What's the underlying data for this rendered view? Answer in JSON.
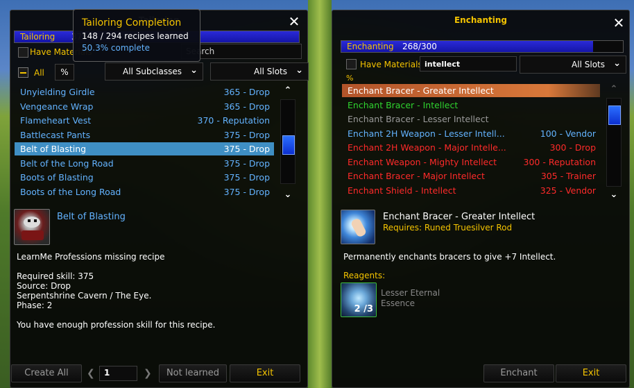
{
  "colors": {
    "yellow": "#f5c400",
    "link_blue": "#63b3ff",
    "red": "#ff2a2a",
    "green": "#2fd32f",
    "gray": "#9a9a9a",
    "selected_row": "#3f8fc4"
  },
  "left": {
    "title": "Tailoring",
    "skill": {
      "name": "Tailoring",
      "value": "375",
      "fill_fraction": 1.0
    },
    "have_materials_label": "Have Materials",
    "search_placeholder": "Search",
    "all_label": "All",
    "percent_label": "%",
    "subclass_dropdown": "All Subclasses",
    "slots_dropdown": "All Slots",
    "recipes": [
      {
        "name": "Unyielding Girdle",
        "source": "365 - Drop"
      },
      {
        "name": "Vengeance Wrap",
        "source": "365 - Drop"
      },
      {
        "name": "Flameheart Vest",
        "source": "370 - Reputation"
      },
      {
        "name": "Battlecast Pants",
        "source": "375 - Drop"
      },
      {
        "name": "Belt of Blasting",
        "source": "375 - Drop",
        "selected": true
      },
      {
        "name": "Belt of the Long Road",
        "source": "375 - Drop"
      },
      {
        "name": "Boots of Blasting",
        "source": "375 - Drop"
      },
      {
        "name": "Boots of the Long Road",
        "source": "375 - Drop"
      }
    ],
    "scroll_position": 0.55,
    "detail": {
      "icon": "belt-icon",
      "name": "Belt of Blasting",
      "addon_line": "LearnMe Professions missing recipe",
      "required_skill": "Required skill: 375",
      "source": "Source: Drop",
      "location": "Serpentshrine Cavern / The Eye.",
      "phase": "Phase: 2",
      "note": "You have enough profession skill for this recipe."
    },
    "buttons": {
      "create_all": "Create All",
      "quantity": "1",
      "not_learned": "Not learned",
      "exit": "Exit"
    }
  },
  "tooltip": {
    "title": "Tailoring Completion",
    "line1": "148 / 294 recipes learned",
    "line2": "50.3% complete"
  },
  "right": {
    "title": "Enchanting",
    "skill": {
      "name": "Enchanting",
      "value": "268/300",
      "fill_fraction": 0.893
    },
    "have_materials_label": "Have Materials",
    "search_value": "intellect",
    "percent_label": "%",
    "slots_dropdown": "All Slots",
    "recipes": [
      {
        "name": "Enchant Bracer - Greater Intellect",
        "source": "",
        "color": "#ffffff",
        "selected": true
      },
      {
        "name": "Enchant Bracer - Intellect",
        "source": "",
        "color": "#2fd32f"
      },
      {
        "name": "Enchant Bracer - Lesser Intellect",
        "source": "",
        "color": "#9a9a9a"
      },
      {
        "name": "Enchant 2H Weapon - Lesser Intell...",
        "source": "100 - Vendor",
        "color": "#63b3ff"
      },
      {
        "name": "Enchant 2H Weapon - Major Intelle...",
        "source": "300 - Drop",
        "color": "#ff2a2a"
      },
      {
        "name": "Enchant Weapon - Mighty Intellect",
        "source": "300 - Reputation",
        "color": "#ff2a2a"
      },
      {
        "name": "Enchant Bracer - Major Intellect",
        "source": "305 - Trainer",
        "color": "#ff2a2a"
      },
      {
        "name": "Enchant Shield - Intellect",
        "source": "325 - Vendor",
        "color": "#ff2a2a"
      }
    ],
    "scroll_position": 0.1,
    "detail": {
      "icon": "enchant-hand-icon",
      "name": "Enchant Bracer - Greater Intellect",
      "requires": "Requires: Runed Truesilver Rod",
      "description": "Permanently enchants bracers to give +7 Intellect.",
      "reagents_label": "Reagents:",
      "reagent": {
        "name_line1": "Lesser Eternal",
        "name_line2": "Essence",
        "count": "2 /3",
        "icon": "essence-icon"
      }
    },
    "buttons": {
      "enchant": "Enchant",
      "exit": "Exit"
    }
  }
}
